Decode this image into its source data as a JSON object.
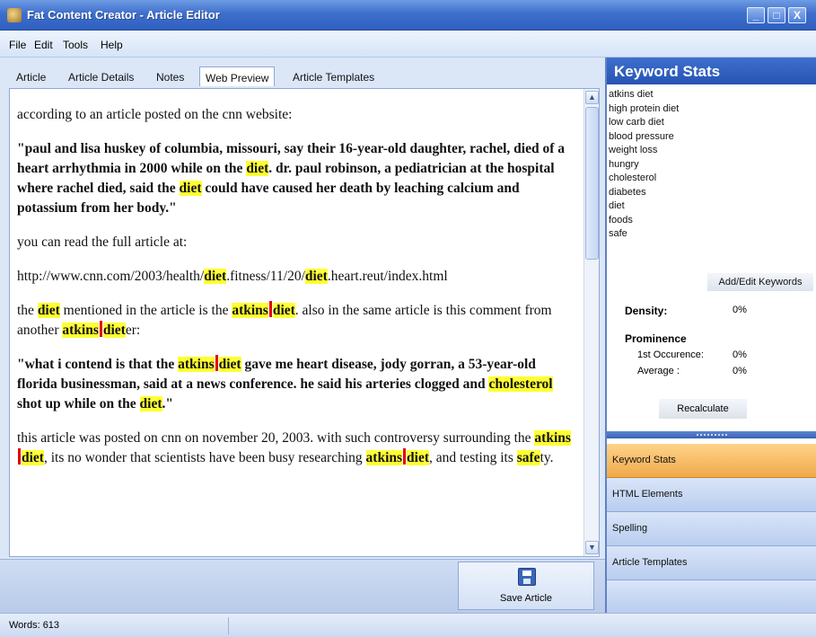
{
  "window": {
    "title": "Fat Content Creator - Article Editor",
    "controls": {
      "minimize": "_",
      "maximize": "□",
      "close": "X"
    }
  },
  "menu": [
    "File",
    "Edit",
    "Tools",
    "Help"
  ],
  "tabs": [
    "Article",
    "Article Details",
    "Notes",
    "Web Preview",
    "Article Templates"
  ],
  "active_tab": "Web Preview",
  "article": {
    "p1": "according to an article posted on the cnn website:",
    "p2": {
      "s1": "\"paul and lisa huskey of columbia, missouri, say their 16-year-old daughter, rachel, died of a heart arrhythmia in 2000 while on the ",
      "k1": "diet",
      "s2": ". dr. paul robinson, a pediatrician at the hospital where rachel died, said the ",
      "k2": "diet",
      "s3": " could have caused her death by leaching calcium and potassium from her body.\""
    },
    "p3": "you can read the full article at:",
    "p4": {
      "s1": "http://www.cnn.com/2003/health/",
      "k1": "diet",
      "s2": ".fitness/11/20/",
      "k2": "diet",
      "s3": ".heart.reut/index.html"
    },
    "p5": {
      "s1": "the ",
      "k1": "diet",
      "s2": " mentioned in the article is the ",
      "k2a": "atkins",
      "k2b": "diet",
      "s3": ". also in the same article is this comment from another ",
      "k3a": "atkins",
      "k3b": "diet",
      "s4": "er:"
    },
    "p6": {
      "s1": "\"what i contend is that the ",
      "k1a": "atkins",
      "k1b": "diet",
      "s2": " gave me heart disease, jody gorran, a 53-year-old florida businessman, said at a news conference. he said his arteries clogged and ",
      "k2": "cholesterol",
      "s3": " shot up while on the ",
      "k3": "diet",
      "s4": ".\""
    },
    "p7": {
      "s1": "this article was posted on cnn on november 20, 2003. with such controversy surrounding the ",
      "k1a": "atkins",
      "k1b": "diet",
      "s2": ", its no wonder that scientists have been busy researching ",
      "k2a": "atkins",
      "k2b": "diet",
      "s3": ", and testing its ",
      "k3": "safe",
      "s4": "ty."
    }
  },
  "save_button": "Save Article",
  "keyword_stats": {
    "title": "Keyword Stats",
    "keywords": [
      "atkins diet",
      "high protein diet",
      "low carb diet",
      "blood pressure",
      "weight loss",
      "hungry",
      "cholesterol",
      "diabetes",
      "diet",
      "foods",
      "safe"
    ],
    "add_edit_label": "Add/Edit Keywords",
    "density_label": "Density:",
    "density_value": "0%",
    "prominence_label": "Prominence",
    "first_occurrence_label": "1st Occurence:",
    "first_occurrence_value": "0%",
    "average_label": "Average :",
    "average_value": "0%",
    "recalculate_label": "Recalculate"
  },
  "side_nav": [
    "Keyword Stats",
    "HTML Elements",
    "Spelling",
    "Article Templates"
  ],
  "side_nav_active": "Keyword Stats",
  "status": {
    "words": "Words: 613"
  },
  "colors": {
    "highlight": "#ffff33",
    "marker": "#e60000",
    "accent": "#2f5fc0",
    "active_nav": "#f0a94a"
  }
}
